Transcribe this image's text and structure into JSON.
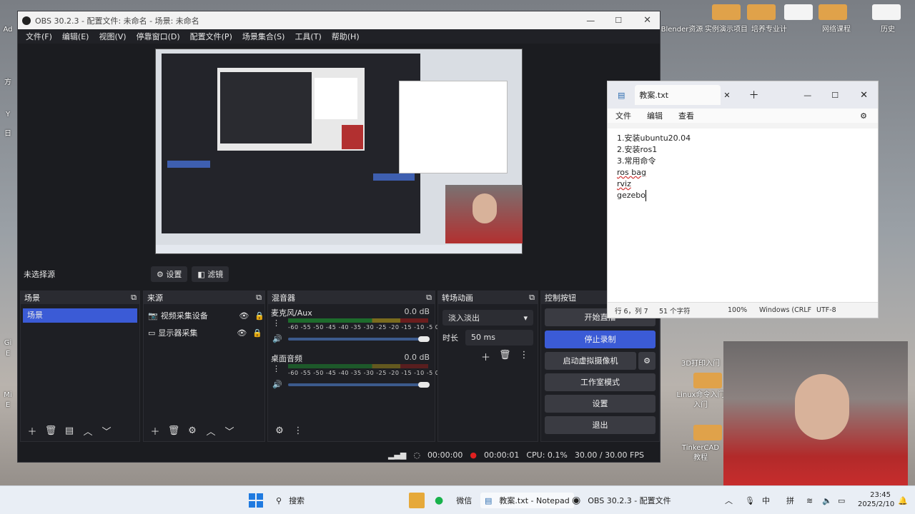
{
  "desktop": {
    "labels": [
      "Blender资源",
      "实例演示项目",
      "培养专业计",
      "网络课程",
      "历史",
      "Ad",
      "方",
      "Y",
      "日",
      "Gi",
      "E",
      "Mi",
      "E",
      "3D打印入门",
      "Linux命令入门",
      "TinkerCAD"
    ],
    "label_tutorial": "教程",
    "label_intro": "入门"
  },
  "obs": {
    "title": "OBS 30.2.3 - 配置文件: 未命名 - 场景: 未命名",
    "menu": [
      "文件(F)",
      "编辑(E)",
      "视图(V)",
      "停靠窗口(D)",
      "配置文件(P)",
      "场景集合(S)",
      "工具(T)",
      "帮助(H)"
    ],
    "source_toolbar": {
      "no_source": "未选择源",
      "settings": "设置",
      "filters": "滤镜"
    },
    "scenes": {
      "title": "场景",
      "items": [
        "场景"
      ]
    },
    "sources": {
      "title": "来源",
      "items": [
        "视频采集设备",
        "显示器采集"
      ]
    },
    "mixer": {
      "title": "混音器",
      "channels": [
        {
          "name": "麦克风/Aux",
          "db": "0.0 dB"
        },
        {
          "name": "桌面音频",
          "db": "0.0 dB"
        }
      ],
      "ticks": "-60 -55 -50 -45 -40 -35 -30 -25 -20 -15 -10 -5 0"
    },
    "transitions": {
      "title": "转场动画",
      "type": "淡入淡出",
      "duration_label": "时长",
      "duration": "50 ms"
    },
    "controls": {
      "title": "控制按钮",
      "buttons": [
        "开始直播",
        "停止录制",
        "启动虚拟摄像机",
        "工作室模式",
        "设置",
        "退出"
      ]
    },
    "status": {
      "stream_time": "00:00:00",
      "rec_time": "00:00:01",
      "cpu": "CPU: 0.1%",
      "fps": "30.00 / 30.00 FPS"
    }
  },
  "notepad": {
    "tab": "教案.txt",
    "menu": [
      "文件",
      "编辑",
      "查看"
    ],
    "lines": [
      "1.安装ubuntu20.04",
      "2.安装ros1",
      "3.常用命令",
      "ros bag",
      "rviz",
      "gezebo"
    ],
    "status": {
      "pos": "行 6，列 7",
      "chars": "51 个字符",
      "zoom": "100%",
      "eol": "Windows (CRLF",
      "enc": "UTF-8"
    }
  },
  "taskbar": {
    "search": "搜索",
    "wechat": "微信",
    "notepad": "教案.txt - Notepad",
    "obs": "OBS 30.2.3 - 配置文件",
    "ime1": "中",
    "ime2": "拼",
    "time": "23:45",
    "date": "2025/2/10"
  },
  "colors": {
    "accent": "#3b5bd6",
    "record": "#e02020",
    "obs_bg": "#1b1c20"
  }
}
